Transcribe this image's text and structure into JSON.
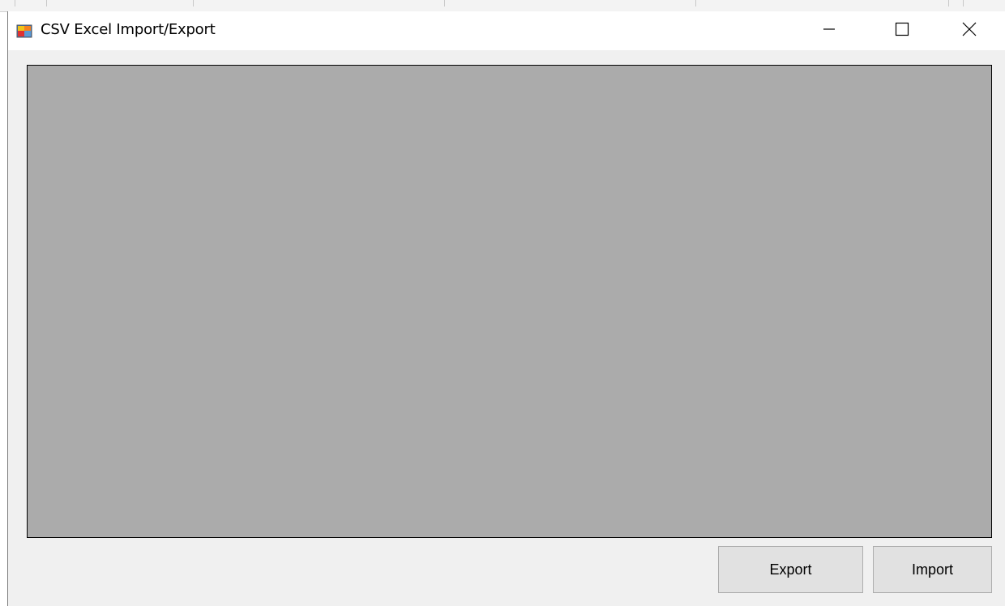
{
  "window": {
    "title": "CSV Excel Import/Export",
    "icon": "winforms-app-icon",
    "controls": {
      "minimize": "minimize-icon",
      "maximize": "maximize-icon",
      "close": "close-icon"
    }
  },
  "main": {
    "grid_background": "#ababab"
  },
  "buttons": {
    "export_label": "Export",
    "import_label": "Import"
  }
}
